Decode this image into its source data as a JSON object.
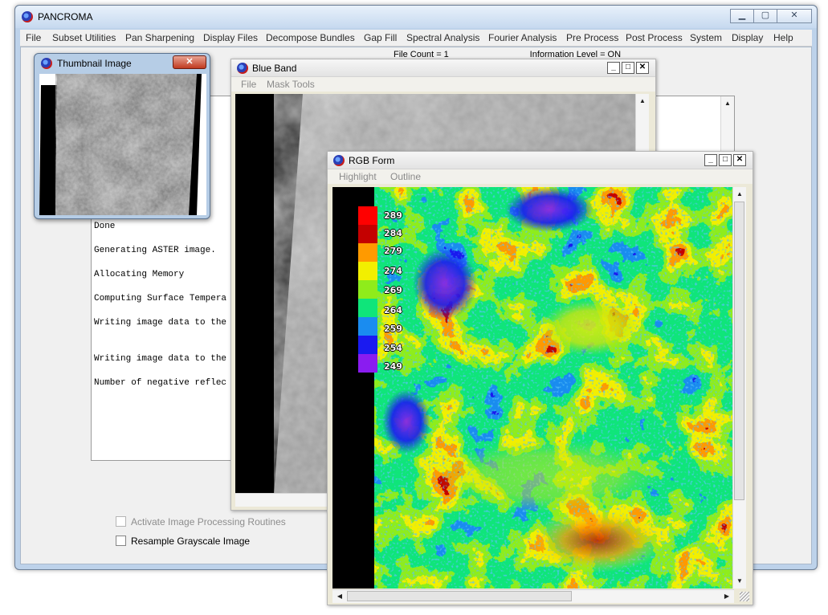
{
  "app": {
    "title": "PANCROMA"
  },
  "menu": [
    "File",
    "Subset Utilities",
    "Pan Sharpening",
    "Display Files",
    "Decompose Bundles",
    "Gap Fill",
    "Spectral Analysis",
    "Fourier Analysis",
    "Pre Process",
    "Post Process",
    "System",
    "Display",
    "Help"
  ],
  "status_fragment": "File Count = 1                                 Information Level = ON",
  "log_lines": [
    "Done",
    "Generating ASTER image.",
    "Allocating Memory",
    "Computing Surface Tempera",
    "Writing image data to the",
    "Writing image data to the",
    "Number of negative reflec"
  ],
  "options": {
    "activate": {
      "label": "Activate Image Processing Routines",
      "checked": false,
      "enabled": false
    },
    "resample": {
      "label": "Resample Grayscale Image",
      "checked": false,
      "enabled": true
    }
  },
  "thumbnail": {
    "title": "Thumbnail Image"
  },
  "blue_band": {
    "title": "Blue Band",
    "menu": [
      "File",
      "Mask Tools"
    ]
  },
  "rgb_form": {
    "title": "RGB Form",
    "menu": [
      "Highlight",
      "Outline"
    ],
    "legend": [
      {
        "label": "289",
        "color": "#ff0000"
      },
      {
        "label": "284",
        "color": "#c40000"
      },
      {
        "label": "279",
        "color": "#ff9a00"
      },
      {
        "label": "274",
        "color": "#f2ef00"
      },
      {
        "label": "269",
        "color": "#8fec1b"
      },
      {
        "label": "264",
        "color": "#0fe57a"
      },
      {
        "label": "259",
        "color": "#1a8cf0"
      },
      {
        "label": "254",
        "color": "#1a1af0"
      },
      {
        "label": "249",
        "color": "#8a1cf0"
      }
    ]
  },
  "icons": {
    "app": "pancroma-icon",
    "close": "close-icon",
    "minimize": "minimize-icon",
    "maximize": "maximize-icon"
  }
}
